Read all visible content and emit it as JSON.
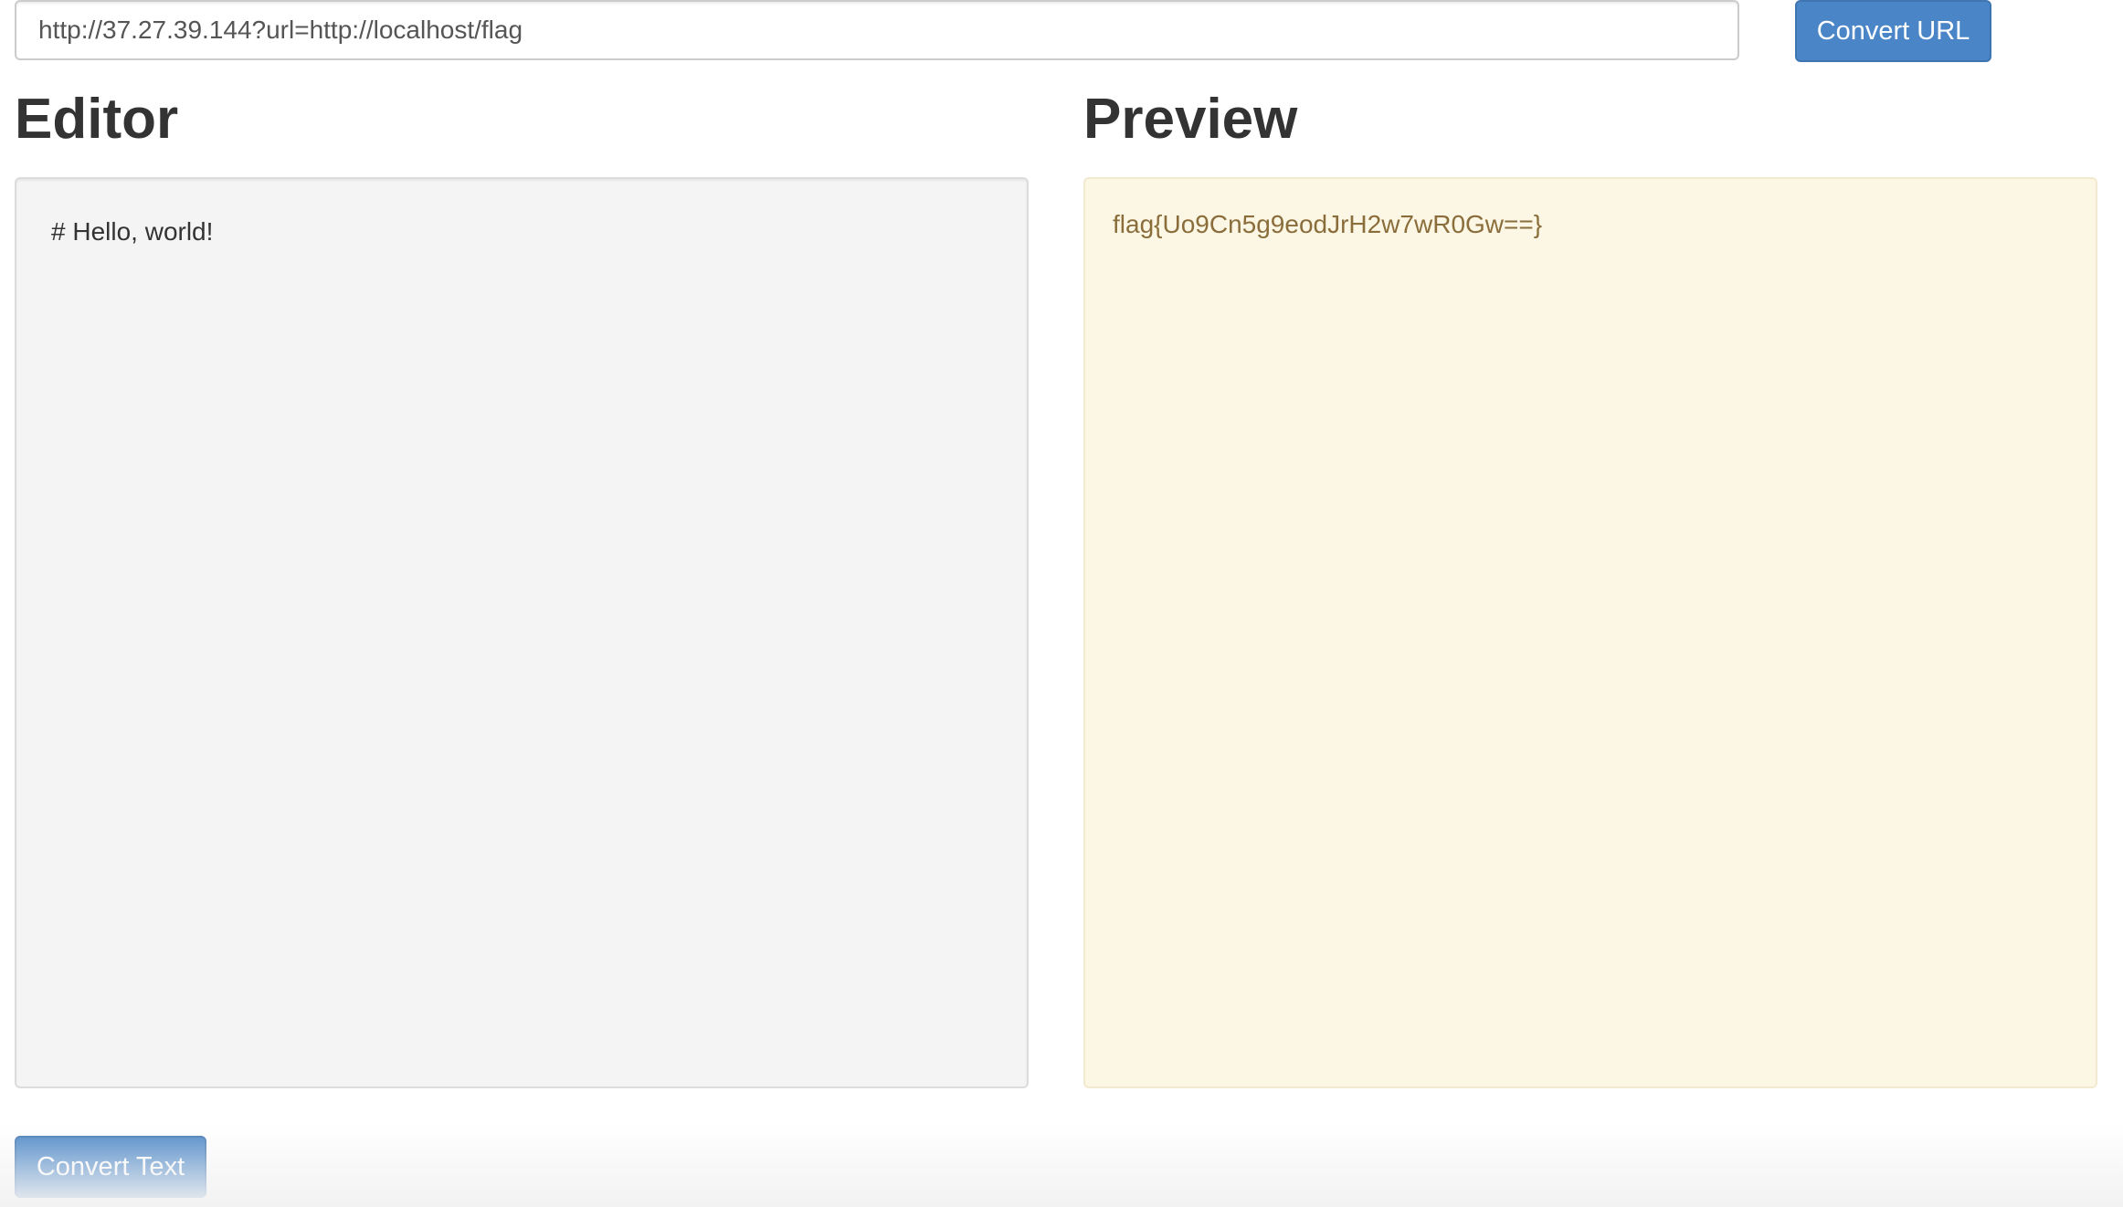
{
  "url_bar": {
    "value": "http://37.27.39.144?url=http://localhost/flag",
    "button_label": "Convert URL"
  },
  "editor": {
    "heading": "Editor",
    "content": "# Hello, world!"
  },
  "preview": {
    "heading": "Preview",
    "content": "flag{Uo9Cn5g9eodJrH2w7wR0Gw==}"
  },
  "convert_text_button": {
    "label": "Convert Text"
  },
  "colors": {
    "button_bg": "#4a86c7",
    "preview_bg": "#fbf7e4",
    "preview_text": "#8a6d3b",
    "editor_bg": "#f4f4f4"
  }
}
